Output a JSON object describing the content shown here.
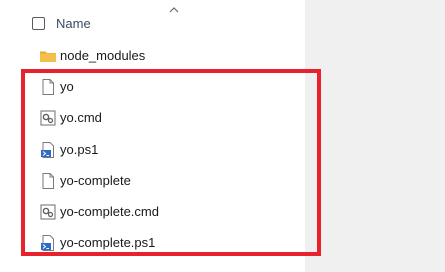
{
  "header": {
    "name_label": "Name"
  },
  "files": [
    {
      "name": "node_modules",
      "icon": "folder-icon"
    },
    {
      "name": "yo",
      "icon": "file-icon"
    },
    {
      "name": "yo.cmd",
      "icon": "cmd-script-icon"
    },
    {
      "name": "yo.ps1",
      "icon": "powershell-script-icon"
    },
    {
      "name": "yo-complete",
      "icon": "file-icon"
    },
    {
      "name": "yo-complete.cmd",
      "icon": "cmd-script-icon"
    },
    {
      "name": "yo-complete.ps1",
      "icon": "powershell-script-icon"
    }
  ],
  "colors": {
    "highlight_border": "#e8222d",
    "folder": "#f4c04b",
    "powershell": "#2d6bc4"
  }
}
